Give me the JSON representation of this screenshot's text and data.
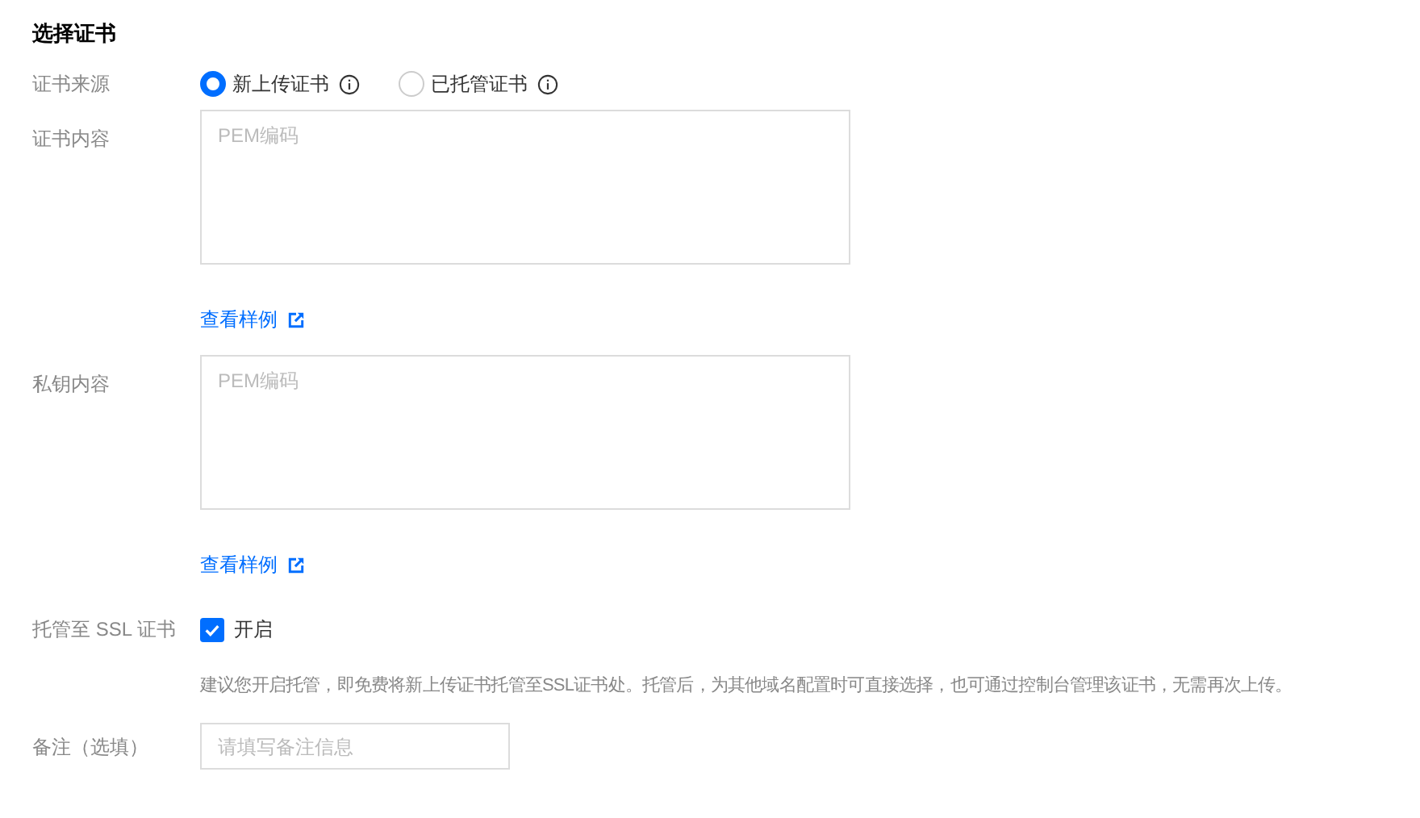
{
  "title": "选择证书",
  "source": {
    "label": "证书来源",
    "options": [
      {
        "label": "新上传证书",
        "selected": true
      },
      {
        "label": "已托管证书",
        "selected": false
      }
    ]
  },
  "cert": {
    "label": "证书内容",
    "placeholder": "PEM编码",
    "link": "查看样例"
  },
  "key": {
    "label": "私钥内容",
    "placeholder": "PEM编码",
    "link": "查看样例"
  },
  "hosting": {
    "label": "托管至 SSL 证书",
    "checkbox": "开启",
    "checked": true,
    "hint": "建议您开启托管，即免费将新上传证书托管至SSL证书处。托管后，为其他域名配置时可直接选择，也可通过控制台管理该证书，无需再次上传。"
  },
  "remark": {
    "label": "备注（选填）",
    "placeholder": "请填写备注信息"
  }
}
